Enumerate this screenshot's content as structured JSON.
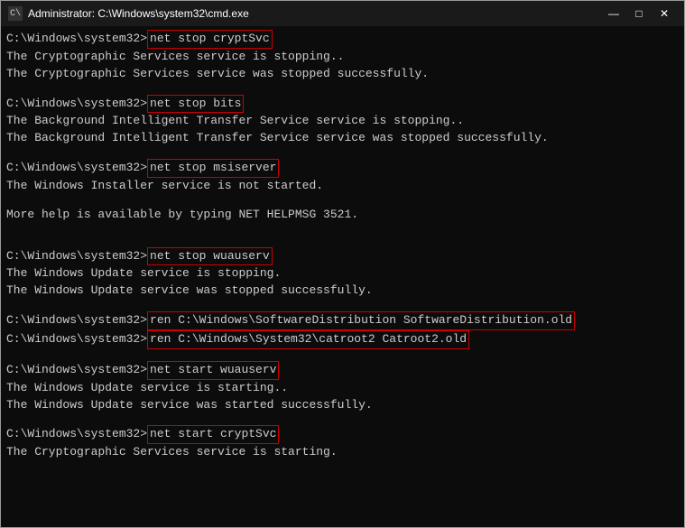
{
  "window": {
    "title": "Administrator: C:\\Windows\\system32\\cmd.exe",
    "icon_label": "C:\\",
    "btn_min": "—",
    "btn_max": "□",
    "btn_close": "✕"
  },
  "terminal": {
    "prompt": "C:\\Windows\\system32>",
    "lines": [
      {
        "type": "cmd",
        "cmd": "net stop cryptSvc"
      },
      {
        "type": "text",
        "text": "The Cryptographic Services service is stopping.."
      },
      {
        "type": "text",
        "text": "The Cryptographic Services service was stopped successfully."
      },
      {
        "type": "blank"
      },
      {
        "type": "cmd",
        "cmd": "net stop bits"
      },
      {
        "type": "text",
        "text": "The Background Intelligent Transfer Service service is stopping.."
      },
      {
        "type": "text",
        "text": "The Background Intelligent Transfer Service service was stopped successfully."
      },
      {
        "type": "blank"
      },
      {
        "type": "cmd",
        "cmd": "net stop msiserver"
      },
      {
        "type": "text",
        "text": "The Windows Installer service is not started."
      },
      {
        "type": "blank"
      },
      {
        "type": "text",
        "text": "More help is available by typing NET HELPMSG 3521."
      },
      {
        "type": "blank"
      },
      {
        "type": "blank"
      },
      {
        "type": "cmd",
        "cmd": "net stop wuauserv"
      },
      {
        "type": "text",
        "text": "The Windows Update service is stopping."
      },
      {
        "type": "text",
        "text": "The Windows Update service was stopped successfully."
      },
      {
        "type": "blank"
      },
      {
        "type": "cmd",
        "cmd": "ren C:\\Windows\\SoftwareDistribution SoftwareDistribution.old"
      },
      {
        "type": "cmd",
        "cmd": "ren C:\\Windows\\System32\\catroot2 Catroot2.old"
      },
      {
        "type": "blank"
      },
      {
        "type": "cmd",
        "cmd": "net start wuauserv"
      },
      {
        "type": "text",
        "text": "The Windows Update service is starting.."
      },
      {
        "type": "text",
        "text": "The Windows Update service was started successfully."
      },
      {
        "type": "blank"
      },
      {
        "type": "cmd",
        "cmd": "net start cryptSvc"
      },
      {
        "type": "text",
        "text": "The Cryptographic Services service is starting."
      }
    ]
  }
}
